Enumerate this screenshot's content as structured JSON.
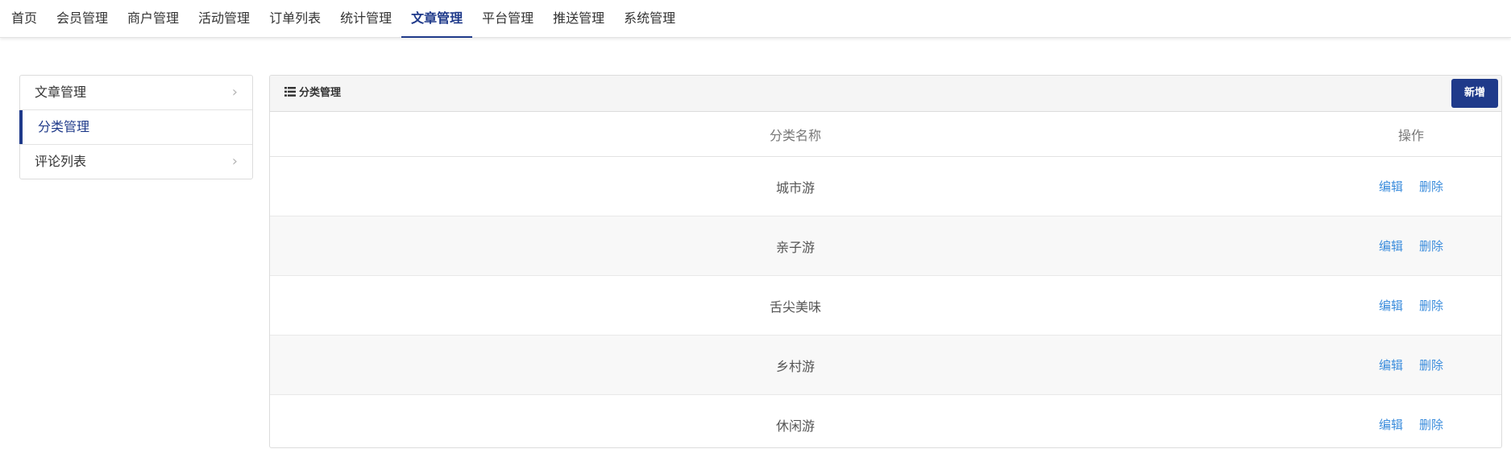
{
  "nav": {
    "items": [
      "首页",
      "会员管理",
      "商户管理",
      "活动管理",
      "订单列表",
      "统计管理",
      "文章管理",
      "平台管理",
      "推送管理",
      "系统管理"
    ],
    "active_index": 6
  },
  "sidebar": {
    "items": [
      {
        "label": "文章管理",
        "has_chevron": true
      },
      {
        "label": "分类管理",
        "has_chevron": false
      },
      {
        "label": "评论列表",
        "has_chevron": true
      }
    ],
    "active_index": 1
  },
  "panel": {
    "title": "分类管理",
    "add_label": "新增",
    "columns": [
      "分类名称",
      "操作"
    ],
    "rows": [
      {
        "name": "城市游",
        "edit": "编辑",
        "delete": "删除"
      },
      {
        "name": "亲子游",
        "edit": "编辑",
        "delete": "删除"
      },
      {
        "name": "舌尖美味",
        "edit": "编辑",
        "delete": "删除"
      },
      {
        "name": "乡村游",
        "edit": "编辑",
        "delete": "删除"
      },
      {
        "name": "休闲游",
        "edit": "编辑",
        "delete": "删除"
      }
    ]
  },
  "colors": {
    "accent": "#1f3a8a",
    "link": "#3c8ddc",
    "stripe": "#f8f8f8"
  }
}
